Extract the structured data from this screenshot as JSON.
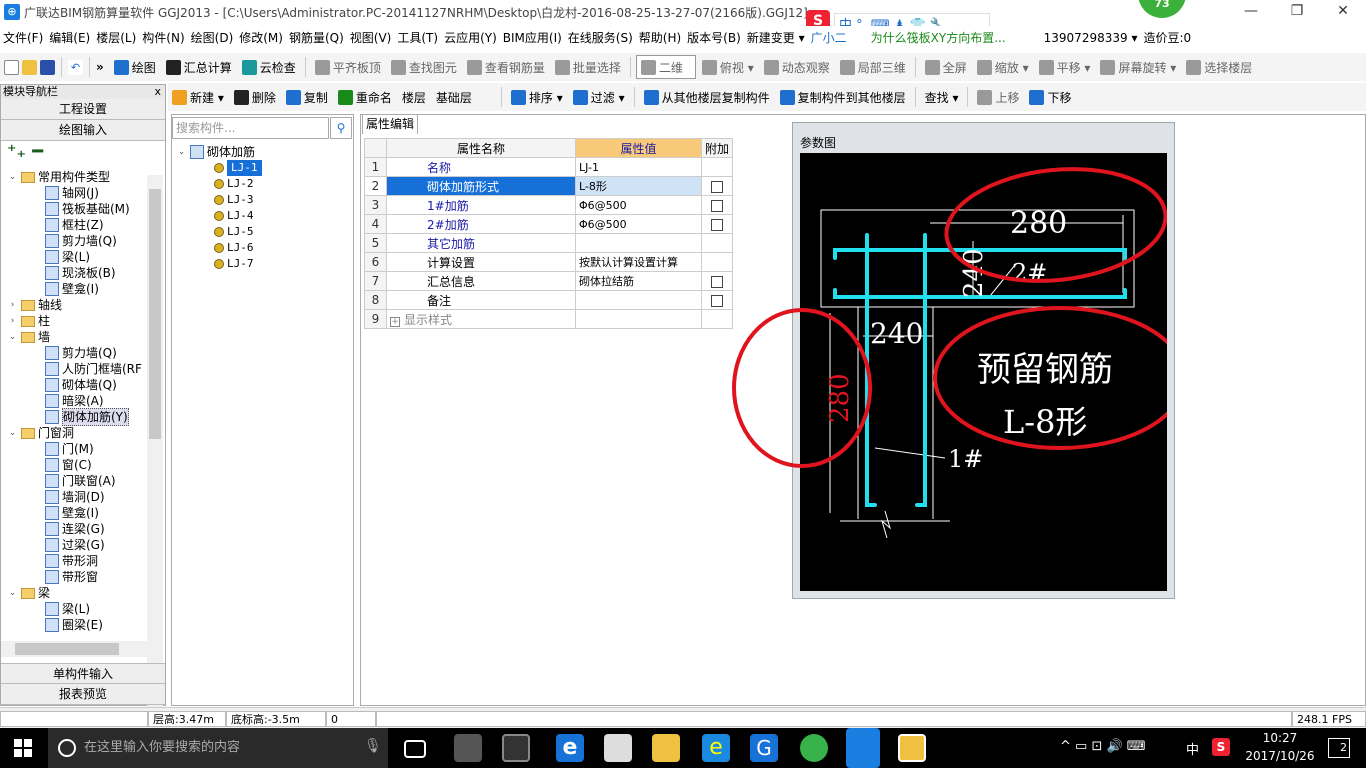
{
  "title": {
    "text": "广联达BIM钢筋算量软件 GGJ2013 - [C:\\Users\\Administrator.PC-20141127NRHM\\Desktop\\白龙村-2016-08-25-13-27-07(2166版).GGJ12]",
    "badge": "73",
    "ime": "中 °, ⌨ ♟ 👕 🔧"
  },
  "menu": [
    "文件(F)",
    "编辑(E)",
    "楼层(L)",
    "构件(N)",
    "绘图(D)",
    "修改(M)",
    "钢筋量(Q)",
    "视图(V)",
    "工具(T)",
    "云应用(Y)",
    "BIM应用(I)",
    "在线服务(S)",
    "帮助(H)",
    "版本号(B)",
    "新建变更 ▾",
    "广小二",
    "为什么筏板XY方向布置...",
    "13907298339 ▾",
    "造价豆:0"
  ],
  "toolbar1": [
    "绘图",
    "汇总计算",
    "云检查",
    "平齐板顶",
    "查找图元",
    "查看钢筋量",
    "批量选择",
    "二维",
    "俯视 ▾",
    "动态观察",
    "局部三维",
    "全屏",
    "缩放 ▾",
    "平移 ▾",
    "屏幕旋转 ▾",
    "选择楼层"
  ],
  "toolbar2": [
    "新建 ▾",
    "删除",
    "复制",
    "重命名",
    "楼层",
    "基础层",
    "排序 ▾",
    "过滤 ▾",
    "从其他楼层复制构件",
    "复制构件到其他楼层",
    "查找 ▾",
    "上移",
    "下移"
  ],
  "nav": {
    "header": "模块导航栏",
    "pin": "ⅹ",
    "btn_project": "工程设置",
    "btn_draw": "绘图输入",
    "btn_single": "单构件输入",
    "btn_report": "报表预览",
    "tree": [
      {
        "label": "常用构件类型",
        "level": 0,
        "type": "folder",
        "exp": "⌄"
      },
      {
        "label": "轴网(J)",
        "level": 1
      },
      {
        "label": "筏板基础(M)",
        "level": 1
      },
      {
        "label": "框柱(Z)",
        "level": 1
      },
      {
        "label": "剪力墙(Q)",
        "level": 1
      },
      {
        "label": "梁(L)",
        "level": 1
      },
      {
        "label": "现浇板(B)",
        "level": 1
      },
      {
        "label": "壁龛(I)",
        "level": 1
      },
      {
        "label": "轴线",
        "level": 0,
        "type": "folder",
        "exp": "›"
      },
      {
        "label": "柱",
        "level": 0,
        "type": "folder",
        "exp": "›"
      },
      {
        "label": "墙",
        "level": 0,
        "type": "folder",
        "exp": "⌄"
      },
      {
        "label": "剪力墙(Q)",
        "level": 1
      },
      {
        "label": "人防门框墙(RF",
        "level": 1
      },
      {
        "label": "砌体墙(Q)",
        "level": 1
      },
      {
        "label": "暗梁(A)",
        "level": 1
      },
      {
        "label": "砌体加筋(Y)",
        "level": 1,
        "selected": true
      },
      {
        "label": "门窗洞",
        "level": 0,
        "type": "folder",
        "exp": "⌄"
      },
      {
        "label": "门(M)",
        "level": 1
      },
      {
        "label": "窗(C)",
        "level": 1
      },
      {
        "label": "门联窗(A)",
        "level": 1
      },
      {
        "label": "墙洞(D)",
        "level": 1
      },
      {
        "label": "壁龛(I)",
        "level": 1
      },
      {
        "label": "连梁(G)",
        "level": 1
      },
      {
        "label": "过梁(G)",
        "level": 1
      },
      {
        "label": "带形洞",
        "level": 1
      },
      {
        "label": "带形窗",
        "level": 1
      },
      {
        "label": "梁",
        "level": 0,
        "type": "folder",
        "exp": "⌄"
      },
      {
        "label": "梁(L)",
        "level": 1
      },
      {
        "label": "圈梁(E)",
        "level": 1
      }
    ]
  },
  "components": {
    "search_placeholder": "搜索构件...",
    "root": "砌体加筋",
    "items": [
      "LJ-1",
      "LJ-2",
      "LJ-3",
      "LJ-4",
      "LJ-5",
      "LJ-6",
      "LJ-7"
    ],
    "selected": "LJ-1"
  },
  "props": {
    "tab": "属性编辑",
    "col_name": "属性名称",
    "col_value": "属性值",
    "col_extra": "附加",
    "rows": [
      {
        "n": "1",
        "name": "名称",
        "value": "LJ-1",
        "chk": false,
        "blue": true
      },
      {
        "n": "2",
        "name": "砌体加筋形式",
        "value": "L-8形",
        "chk": true,
        "sel": true
      },
      {
        "n": "3",
        "name": "1#加筋",
        "value": "Φ6@500",
        "chk": true,
        "blue": true
      },
      {
        "n": "4",
        "name": "2#加筋",
        "value": "Φ6@500",
        "chk": true,
        "blue": true
      },
      {
        "n": "5",
        "name": "其它加筋",
        "value": "",
        "chk": false,
        "blue": true
      },
      {
        "n": "6",
        "name": "计算设置",
        "value": "按默认计算设置计算",
        "chk": false
      },
      {
        "n": "7",
        "name": "汇总信息",
        "value": "砌体拉结筋",
        "chk": true
      },
      {
        "n": "8",
        "name": "备注",
        "value": "",
        "chk": true
      },
      {
        "n": "9",
        "name": "显示样式",
        "value": "",
        "chk": false,
        "expand": "+"
      }
    ]
  },
  "param": {
    "title": "参数图",
    "dim_top": "280",
    "dim_left": "280",
    "dim_mid": "240",
    "dim_vert": "240",
    "label_2": "2#",
    "label_1": "1#",
    "text1": "预留钢筋",
    "text2": "L-8形"
  },
  "status": {
    "floor_h": "层高:3.47m",
    "base_h": "底标高:-3.5m",
    "zero": "0",
    "fps": "248.1 FPS"
  },
  "taskbar": {
    "search": "在这里输入你要搜索的内容",
    "time": "10:27",
    "date": "2017/10/26",
    "lang": "中",
    "notif": "2"
  },
  "colors": {
    "accent": "#1770d8",
    "cad_cyan": "#20e0f0",
    "annot_red": "#e0141e"
  }
}
